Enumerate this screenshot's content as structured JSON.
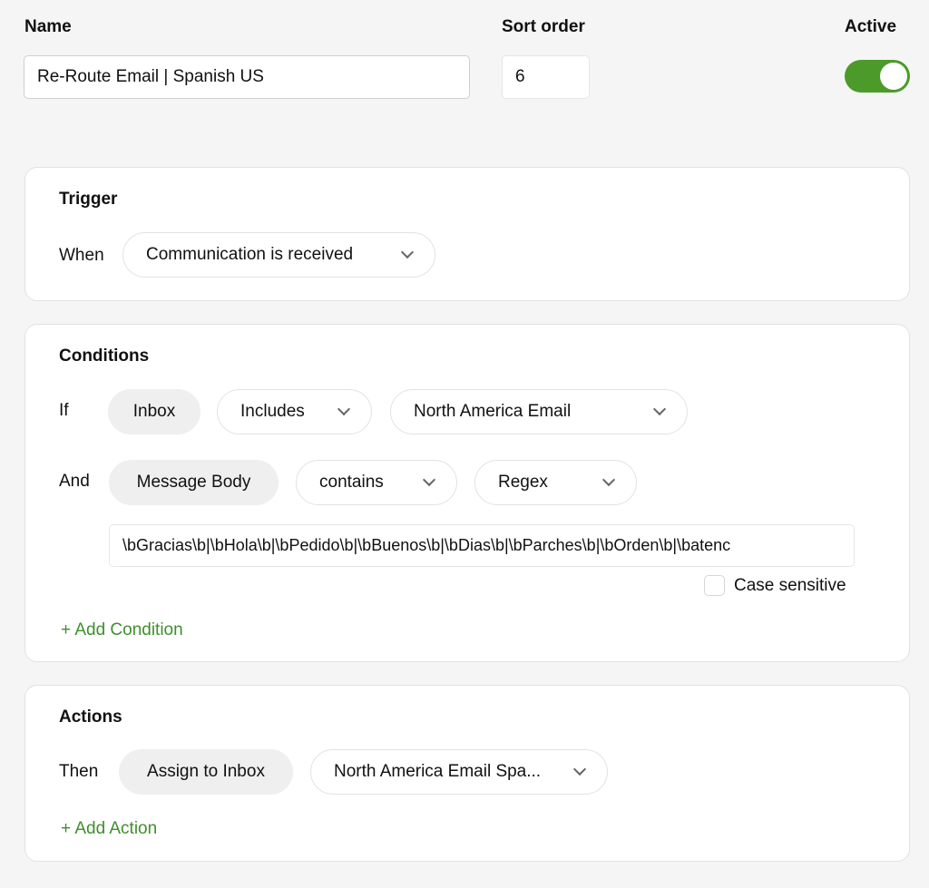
{
  "header": {
    "name_label": "Name",
    "name_value": "Re-Route Email | Spanish US",
    "sort_label": "Sort order",
    "sort_value": "6",
    "active_label": "Active",
    "active_on": true,
    "accent_color": "#4c9a2a"
  },
  "trigger": {
    "title": "Trigger",
    "when_label": "When",
    "when_value": "Communication is received"
  },
  "conditions": {
    "title": "Conditions",
    "rows": [
      {
        "prefix": "If",
        "field": "Inbox",
        "operator": "Includes",
        "value": "North America Email"
      },
      {
        "prefix": "And",
        "field": "Message Body",
        "operator": "contains",
        "value": "Regex"
      }
    ],
    "regex_value": "\\bGracias\\b|\\bHola\\b|\\bPedido\\b|\\bBuenos\\b|\\bDias\\b|\\bParches\\b|\\bOrden\\b|\\batenc",
    "case_sensitive_label": "Case sensitive",
    "case_sensitive": false,
    "add_label": "+ Add Condition"
  },
  "actions": {
    "title": "Actions",
    "then_label": "Then",
    "action": "Assign to Inbox",
    "value": "North America Email Spa...",
    "add_label": "+ Add Action"
  }
}
